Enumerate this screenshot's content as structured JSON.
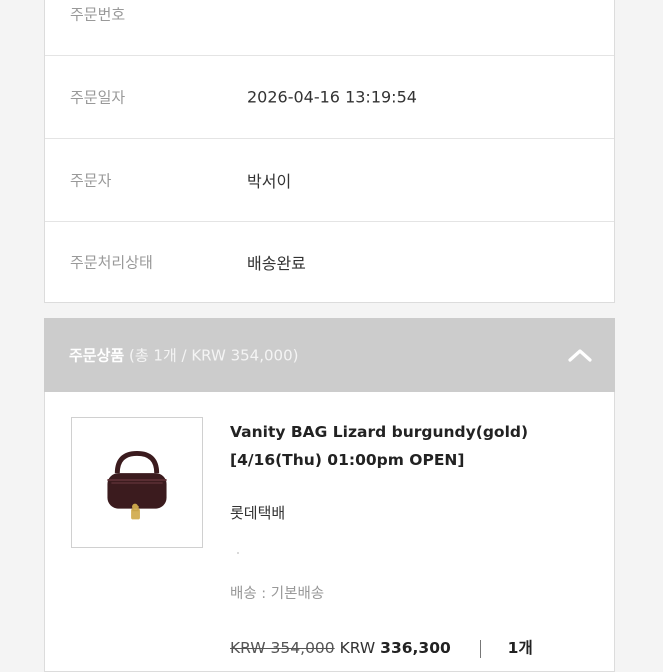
{
  "order_info": {
    "rows": [
      {
        "label": "주문번호",
        "value": ""
      },
      {
        "label": "주문일자",
        "value": "2026-04-16 13:19:54"
      },
      {
        "label": "주문자",
        "value": "박서이"
      },
      {
        "label": "주문처리상태",
        "value": "배송완료"
      }
    ]
  },
  "products_section": {
    "title": "주문상품",
    "summary": "(총 1개 / KRW 354,000)",
    "collapse_icon": "chevron-up-icon"
  },
  "product": {
    "name_line1": "Vanity BAG Lizard burgundy(gold)",
    "name_line2": "[4/16(Thu) 01:00pm OPEN]",
    "delivery_company": "롯데택배",
    "shipping": "배송 : 기본배송",
    "original_price": "KRW 354,000",
    "price_currency": "KRW",
    "price_amount": "336,300",
    "quantity": "1개",
    "image_icon": "vanity-bag-image"
  },
  "colors": {
    "header_bg": "#cccccc",
    "bag": "#3b1b1e"
  }
}
